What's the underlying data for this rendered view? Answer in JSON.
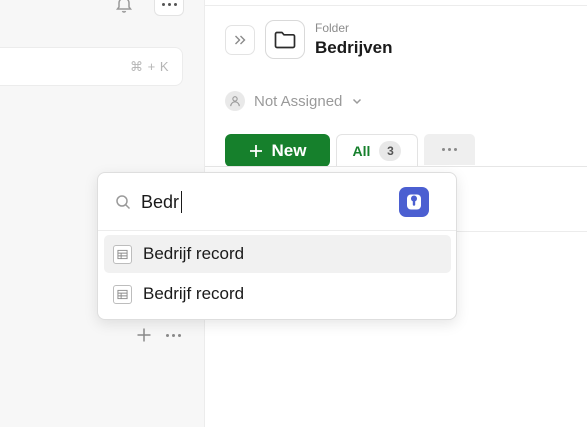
{
  "sidebar": {
    "shortcut_hint": "⌘ + K"
  },
  "header": {
    "folder_kind": "Folder",
    "folder_name": "Bedrijven",
    "assignee": "Not Assigned"
  },
  "toolbar": {
    "new_label": "New",
    "tab_all_label": "All",
    "tab_all_count": "3"
  },
  "popup": {
    "search_value": "Bedr",
    "results": [
      {
        "label": "Bedrijf record",
        "highlighted": true
      },
      {
        "label": "Bedrijf record",
        "highlighted": false
      }
    ]
  },
  "colors": {
    "accent": "#16802c",
    "extension_icon_bg": "#4b5fd1"
  },
  "icons": [
    "bell-icon",
    "more-icon",
    "expand-icon",
    "folder-icon",
    "user-icon",
    "chevron-down-icon",
    "plus-icon",
    "search-icon",
    "password-manager-icon",
    "table-icon"
  ]
}
